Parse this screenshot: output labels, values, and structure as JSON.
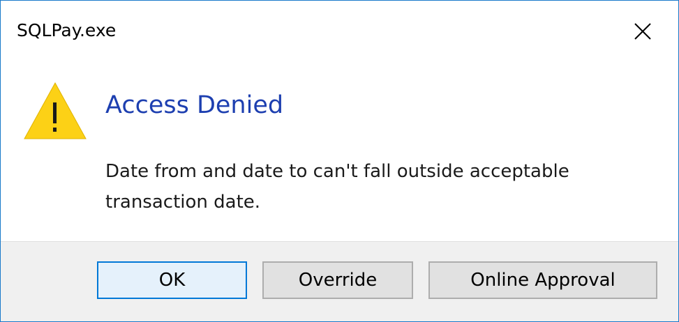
{
  "window": {
    "title": "SQLPay.exe",
    "close_icon": "close-icon"
  },
  "content": {
    "icon": "warning-icon",
    "heading": "Access Denied",
    "message": "Date from and date to can't fall outside acceptable transaction date."
  },
  "buttons": {
    "ok": "OK",
    "override": "Override",
    "online_approval": "Online Approval"
  },
  "colors": {
    "heading": "#1d3fb0",
    "window_border": "#1979ca",
    "footer_background": "#f0f0f0",
    "default_button_border": "#0078d7",
    "warning_fill": "#fcd116"
  }
}
